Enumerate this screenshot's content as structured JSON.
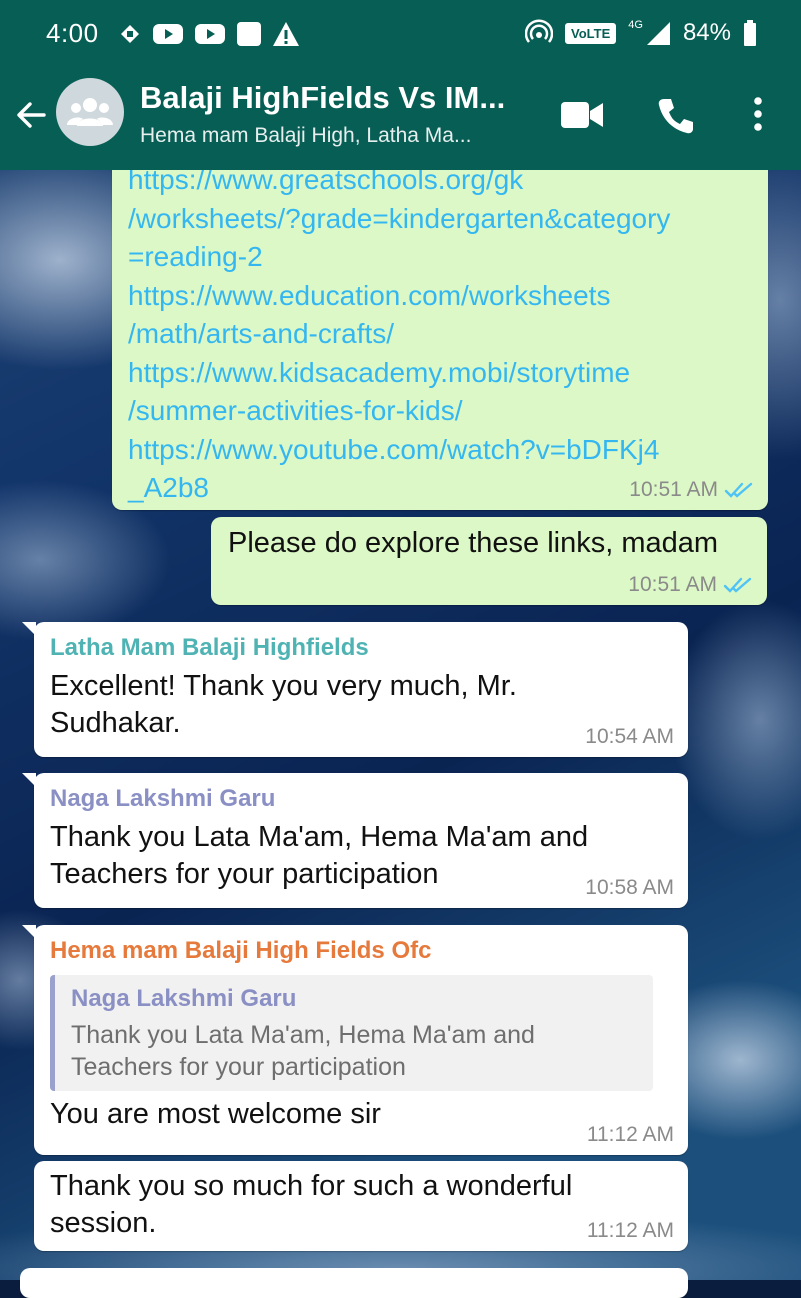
{
  "status_bar": {
    "time": "4:00",
    "network": "4G",
    "volte": "VoLTE",
    "battery": "84%"
  },
  "header": {
    "title": "Balaji HighFields Vs IM...",
    "subtitle": "Hema mam Balaji High, Latha Ma...",
    "icons": [
      "back-arrow-icon",
      "group-avatar-icon",
      "video-call-icon",
      "voice-call-icon",
      "more-options-icon"
    ]
  },
  "messages": [
    {
      "direction": "outgoing",
      "links": [
        "https://www.greatschools.org/gk",
        "/worksheets/?grade=kindergarten&category",
        "=reading-2",
        "https://www.education.com/worksheets",
        "/math/arts-and-crafts/",
        "https://www.kidsacademy.mobi/storytime",
        "/summer-activities-for-kids/",
        "https://www.youtube.com/watch?v=bDFKj4",
        "_A2b8"
      ],
      "time": "10:51 AM",
      "status": "read"
    },
    {
      "direction": "outgoing",
      "text": "Please do explore these links, madam",
      "time": "10:51 AM",
      "status": "read"
    },
    {
      "direction": "incoming",
      "sender": "Latha Mam Balaji Highfields",
      "sender_color": "#4fb3b3",
      "text": "Excellent! Thank you very much, Mr. Sudhakar.",
      "time": "10:54 AM"
    },
    {
      "direction": "incoming",
      "sender": "Naga Lakshmi Garu",
      "sender_color": "#8a8fc4",
      "text": "Thank you Lata Ma'am, Hema Ma'am and Teachers for your participation",
      "time": "10:58 AM"
    },
    {
      "direction": "incoming",
      "sender": "Hema mam Balaji High Fields Ofc",
      "sender_color": "#e67a3c",
      "quoted": {
        "sender": "Naga Lakshmi Garu",
        "text": "Thank you Lata Ma'am, Hema Ma'am and Teachers for your participation"
      },
      "text": "You are most welcome sir",
      "time": "11:12 AM"
    },
    {
      "direction": "incoming",
      "text": "Thank you so much for such a wonderful session.",
      "time": "11:12 AM"
    }
  ],
  "colors": {
    "header_bg": "#075e54",
    "outgoing_bubble": "#dcf8c6",
    "incoming_bubble": "#ffffff",
    "link": "#34b7f1",
    "read_ticks": "#4fc3f7"
  }
}
